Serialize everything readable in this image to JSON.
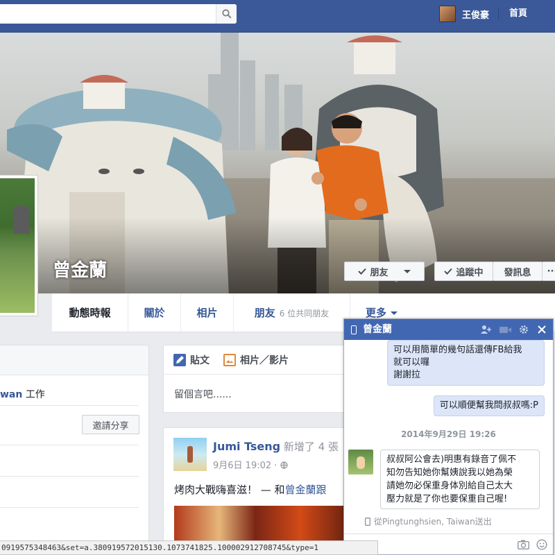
{
  "topbar": {
    "search_placeholder": "",
    "user_name": "王俊豪",
    "home_label": "首頁"
  },
  "profile": {
    "name": "曾金蘭",
    "friend_button": "朋友",
    "follow_button": "追蹤中",
    "message_button": "發訊息",
    "more_button": "···"
  },
  "tabs": {
    "timeline": "動態時報",
    "about": "關於",
    "photos": "相片",
    "friends": "朋友",
    "mutual_friends": "6 位共同朋友",
    "more": "更多"
  },
  "left": {
    "work_prefix": "wan",
    "work_suffix": "工作",
    "invite_button": "邀請分享"
  },
  "composer": {
    "post_label": "貼文",
    "photo_label": "相片／影片",
    "placeholder": "留個言吧......"
  },
  "post": {
    "author": "Jumi Tseng",
    "action": "新增了 4 張",
    "date": "9月6日 19:02 ·",
    "text_prefix": "烤肉大戰嗨喜滋！ — 和",
    "text_link": "曾金蘭跟"
  },
  "chat": {
    "title": "曾金蘭",
    "msg_out_1_l1": "可以用簡單的幾句話還傳FB給我",
    "msg_out_1_l2": "就可以囉",
    "msg_out_1_l3": "謝謝拉",
    "msg_out_2": "可以順便幫我問叔叔嗎:P",
    "date_divider": "2014年9月29日 19:26",
    "msg_in_l1": "叔叔阿公會去)明惠有錄音了佩不",
    "msg_in_l2": "知勿告知她你幫姨說我以她為榮",
    "msg_in_l3": "請她勿必保重身体別給自己太大",
    "msg_in_l4": "壓力就是了你也要保重自己喔!",
    "sent_from": "從Pingtunghsien, Taiwan送出"
  },
  "status_url": "0919575348463&set=a.380919572015130.1073741825.100002912708745&type=1",
  "colors": {
    "topbar": "#3b5998",
    "link": "#365899",
    "chat_header": "#4267b2",
    "bubble_out": "#dce6f8"
  }
}
